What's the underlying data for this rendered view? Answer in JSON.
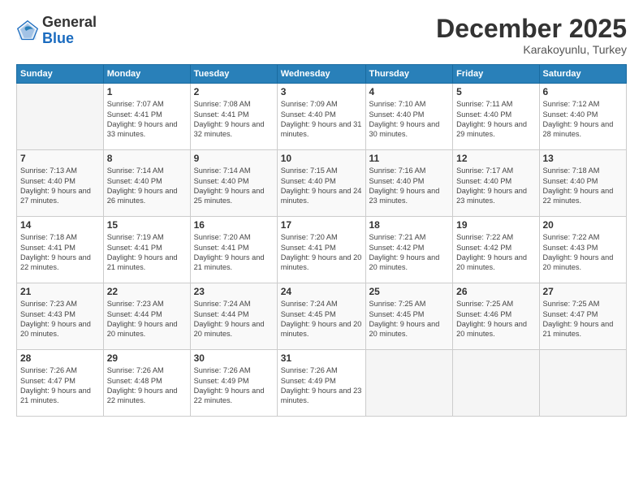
{
  "header": {
    "logo_general": "General",
    "logo_blue": "Blue",
    "month_title": "December 2025",
    "location": "Karakoyunlu, Turkey"
  },
  "days_of_week": [
    "Sunday",
    "Monday",
    "Tuesday",
    "Wednesday",
    "Thursday",
    "Friday",
    "Saturday"
  ],
  "weeks": [
    [
      {
        "day": "",
        "empty": true
      },
      {
        "day": "1",
        "sunrise": "7:07 AM",
        "sunset": "4:41 PM",
        "daylight": "9 hours and 33 minutes."
      },
      {
        "day": "2",
        "sunrise": "7:08 AM",
        "sunset": "4:41 PM",
        "daylight": "9 hours and 32 minutes."
      },
      {
        "day": "3",
        "sunrise": "7:09 AM",
        "sunset": "4:40 PM",
        "daylight": "9 hours and 31 minutes."
      },
      {
        "day": "4",
        "sunrise": "7:10 AM",
        "sunset": "4:40 PM",
        "daylight": "9 hours and 30 minutes."
      },
      {
        "day": "5",
        "sunrise": "7:11 AM",
        "sunset": "4:40 PM",
        "daylight": "9 hours and 29 minutes."
      },
      {
        "day": "6",
        "sunrise": "7:12 AM",
        "sunset": "4:40 PM",
        "daylight": "9 hours and 28 minutes."
      }
    ],
    [
      {
        "day": "7",
        "sunrise": "7:13 AM",
        "sunset": "4:40 PM",
        "daylight": "9 hours and 27 minutes."
      },
      {
        "day": "8",
        "sunrise": "7:14 AM",
        "sunset": "4:40 PM",
        "daylight": "9 hours and 26 minutes."
      },
      {
        "day": "9",
        "sunrise": "7:14 AM",
        "sunset": "4:40 PM",
        "daylight": "9 hours and 25 minutes."
      },
      {
        "day": "10",
        "sunrise": "7:15 AM",
        "sunset": "4:40 PM",
        "daylight": "9 hours and 24 minutes."
      },
      {
        "day": "11",
        "sunrise": "7:16 AM",
        "sunset": "4:40 PM",
        "daylight": "9 hours and 23 minutes."
      },
      {
        "day": "12",
        "sunrise": "7:17 AM",
        "sunset": "4:40 PM",
        "daylight": "9 hours and 23 minutes."
      },
      {
        "day": "13",
        "sunrise": "7:18 AM",
        "sunset": "4:40 PM",
        "daylight": "9 hours and 22 minutes."
      }
    ],
    [
      {
        "day": "14",
        "sunrise": "7:18 AM",
        "sunset": "4:41 PM",
        "daylight": "9 hours and 22 minutes."
      },
      {
        "day": "15",
        "sunrise": "7:19 AM",
        "sunset": "4:41 PM",
        "daylight": "9 hours and 21 minutes."
      },
      {
        "day": "16",
        "sunrise": "7:20 AM",
        "sunset": "4:41 PM",
        "daylight": "9 hours and 21 minutes."
      },
      {
        "day": "17",
        "sunrise": "7:20 AM",
        "sunset": "4:41 PM",
        "daylight": "9 hours and 20 minutes."
      },
      {
        "day": "18",
        "sunrise": "7:21 AM",
        "sunset": "4:42 PM",
        "daylight": "9 hours and 20 minutes."
      },
      {
        "day": "19",
        "sunrise": "7:22 AM",
        "sunset": "4:42 PM",
        "daylight": "9 hours and 20 minutes."
      },
      {
        "day": "20",
        "sunrise": "7:22 AM",
        "sunset": "4:43 PM",
        "daylight": "9 hours and 20 minutes."
      }
    ],
    [
      {
        "day": "21",
        "sunrise": "7:23 AM",
        "sunset": "4:43 PM",
        "daylight": "9 hours and 20 minutes."
      },
      {
        "day": "22",
        "sunrise": "7:23 AM",
        "sunset": "4:44 PM",
        "daylight": "9 hours and 20 minutes."
      },
      {
        "day": "23",
        "sunrise": "7:24 AM",
        "sunset": "4:44 PM",
        "daylight": "9 hours and 20 minutes."
      },
      {
        "day": "24",
        "sunrise": "7:24 AM",
        "sunset": "4:45 PM",
        "daylight": "9 hours and 20 minutes."
      },
      {
        "day": "25",
        "sunrise": "7:25 AM",
        "sunset": "4:45 PM",
        "daylight": "9 hours and 20 minutes."
      },
      {
        "day": "26",
        "sunrise": "7:25 AM",
        "sunset": "4:46 PM",
        "daylight": "9 hours and 20 minutes."
      },
      {
        "day": "27",
        "sunrise": "7:25 AM",
        "sunset": "4:47 PM",
        "daylight": "9 hours and 21 minutes."
      }
    ],
    [
      {
        "day": "28",
        "sunrise": "7:26 AM",
        "sunset": "4:47 PM",
        "daylight": "9 hours and 21 minutes."
      },
      {
        "day": "29",
        "sunrise": "7:26 AM",
        "sunset": "4:48 PM",
        "daylight": "9 hours and 22 minutes."
      },
      {
        "day": "30",
        "sunrise": "7:26 AM",
        "sunset": "4:49 PM",
        "daylight": "9 hours and 22 minutes."
      },
      {
        "day": "31",
        "sunrise": "7:26 AM",
        "sunset": "4:49 PM",
        "daylight": "9 hours and 23 minutes."
      },
      {
        "day": "",
        "empty": true
      },
      {
        "day": "",
        "empty": true
      },
      {
        "day": "",
        "empty": true
      }
    ]
  ]
}
